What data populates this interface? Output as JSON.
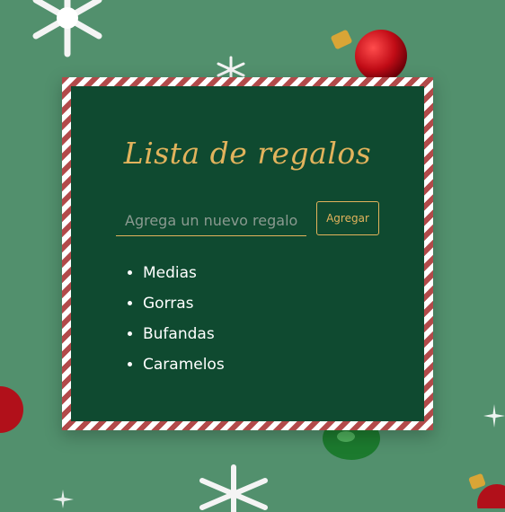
{
  "title": "Lista de regalos",
  "input": {
    "placeholder": "Agrega un nuevo regalo",
    "value": ""
  },
  "add_button": {
    "label": "Agregar"
  },
  "gifts": [
    {
      "label": "Medias"
    },
    {
      "label": "Gorras"
    },
    {
      "label": "Bufandas"
    },
    {
      "label": "Caramelos"
    }
  ],
  "colors": {
    "background": "#52906d",
    "card": "#0f4a30",
    "accent": "#e2b35c",
    "stripe": "#b24a4a"
  },
  "decorations": [
    "snowflake-icon",
    "ornament-red-icon",
    "ornament-green-icon",
    "sparkle-icon"
  ]
}
